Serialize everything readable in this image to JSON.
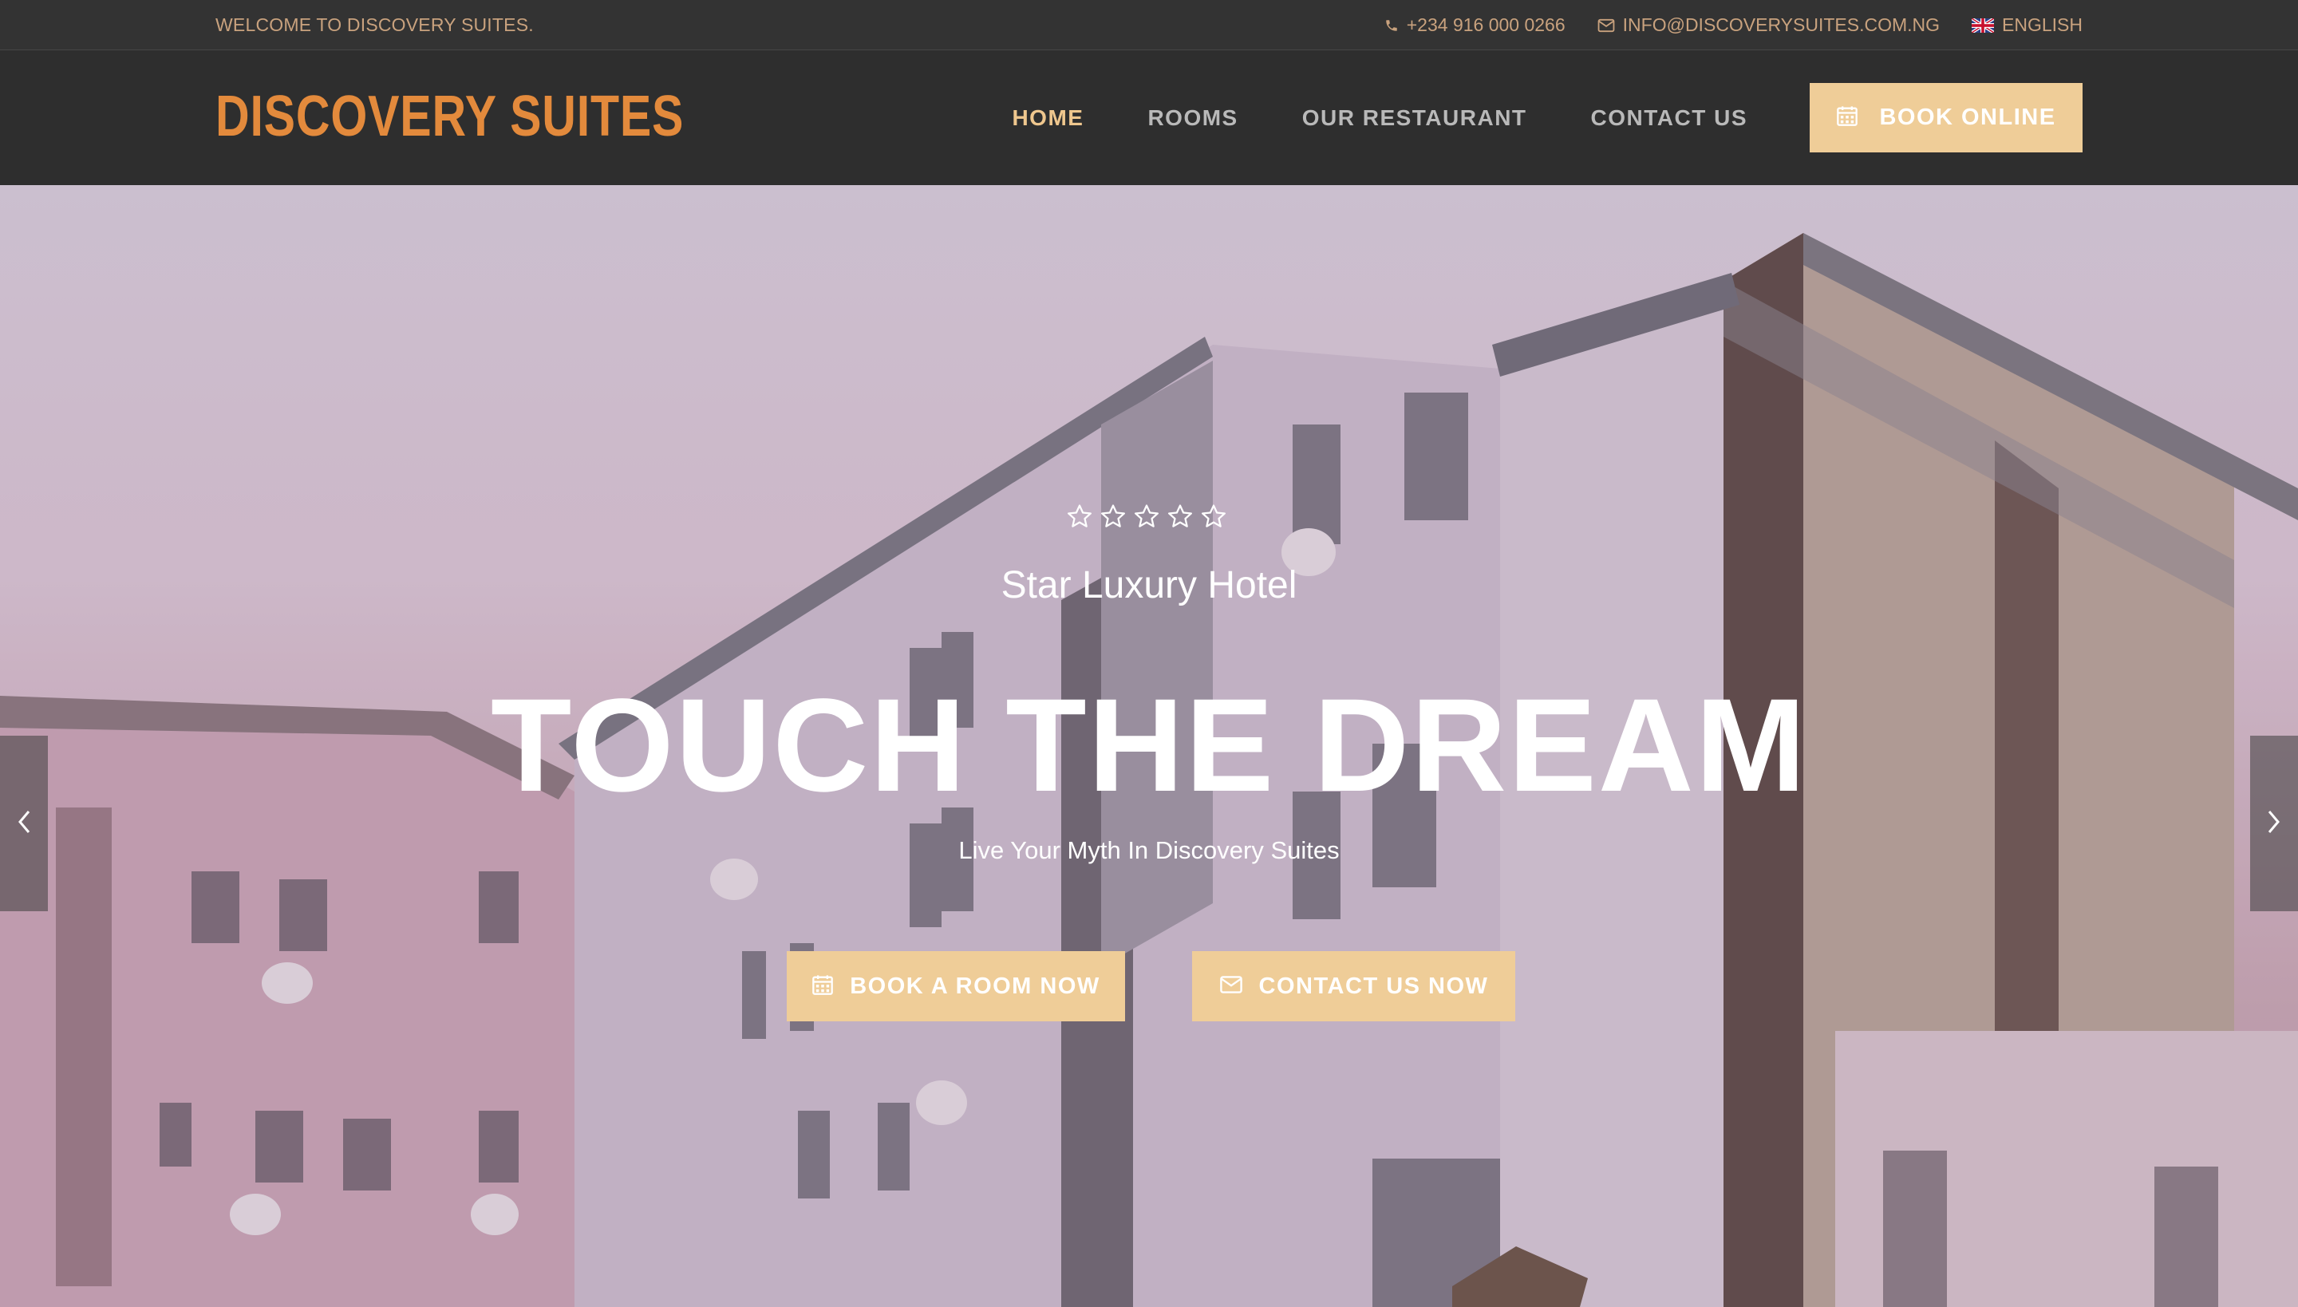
{
  "topbar": {
    "welcome": "WELCOME TO DISCOVERY SUITES.",
    "phone": "+234 916 000 0266",
    "email": "INFO@DISCOVERYSUITES.COM.NG",
    "language": "ENGLISH",
    "icons": {
      "phone": "phone-icon",
      "email": "envelope-icon",
      "language": "uk-flag-icon"
    }
  },
  "header": {
    "logo": "DISCOVERY SUITES",
    "nav": [
      {
        "label": "HOME",
        "active": true
      },
      {
        "label": "ROOMS",
        "active": false
      },
      {
        "label": "OUR RESTAURANT",
        "active": false
      },
      {
        "label": "CONTACT US",
        "active": false
      }
    ],
    "book_online": "BOOK ONLINE"
  },
  "hero": {
    "star_count": 5,
    "tagline": "Star Luxury Hotel",
    "headline": "TOUCH THE DREAM",
    "subline": "Live Your Myth In Discovery Suites",
    "buttons": {
      "book": "BOOK A ROOM NOW",
      "contact": "CONTACT US NOW"
    }
  },
  "colors": {
    "accent": "#efcd98",
    "nav_active": "#efc78e",
    "logo": "#e38a3c",
    "topbar_text": "#c9a27e",
    "dark_bg": "#2e2e2e"
  }
}
